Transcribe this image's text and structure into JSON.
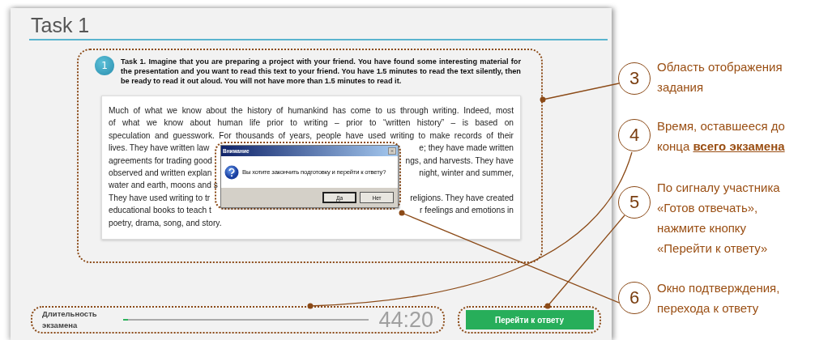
{
  "task_title": "Task 1",
  "task": {
    "number": "1",
    "instruction": "Task 1. Imagine that you are preparing a project with your friend. You have found some interesting material for the presentation and you want to read this text to your friend. You have 1.5 minutes to read the text silently, then be ready to read it out aloud. You will not have more than 1.5 minutes to read it.",
    "passage": [
      {
        "kind": "full",
        "left": "Much of what we know about the history of humankind has come to us through writing. Indeed, most"
      },
      {
        "kind": "full",
        "left": "of what we know about human life prior to writing – prior to “written history” – is based on"
      },
      {
        "kind": "full",
        "left": "speculation and guesswork. For thousands of years, people have used writing to make records of their"
      },
      {
        "kind": "split",
        "left": "lives. They have written law",
        "right": "e; they have made written"
      },
      {
        "kind": "split",
        "left": "agreements for trading good",
        "right": "ngs, and harvests. They have"
      },
      {
        "kind": "split",
        "left": "observed and written explan",
        "right": "night, winter and summer,"
      },
      {
        "kind": "split",
        "left": "water and earth, moons and s"
      },
      {
        "kind": "split",
        "left": "They have used writing to tr",
        "right": "religions. They have created"
      },
      {
        "kind": "split",
        "left": "educational books to teach t",
        "right": "r feelings and emotions in"
      },
      {
        "kind": "end",
        "left": "poetry, drama, song, and story."
      }
    ]
  },
  "dialog": {
    "title": "Внимание",
    "message": "Вы хотите закончить подготовку и перейти к ответу?",
    "buttons": [
      "Да",
      "Нет"
    ]
  },
  "footer": {
    "duration_label": "Длительность экзамена",
    "progress": {
      "level": 0.02
    },
    "timer": "44:20",
    "next_button": "Перейти к ответу"
  },
  "callouts": [
    {
      "number": "3",
      "text": "Область отображения задания"
    },
    {
      "number": "4",
      "text": "Время, оставшееся до конца **всего экзамена**"
    },
    {
      "number": "5",
      "text": "По сигналу участника «Готов отвечать», нажмите кнопку «Перейти к ответу»"
    },
    {
      "number": "6",
      "text": "Окно подтверждения, перехода к ответу"
    }
  ]
}
